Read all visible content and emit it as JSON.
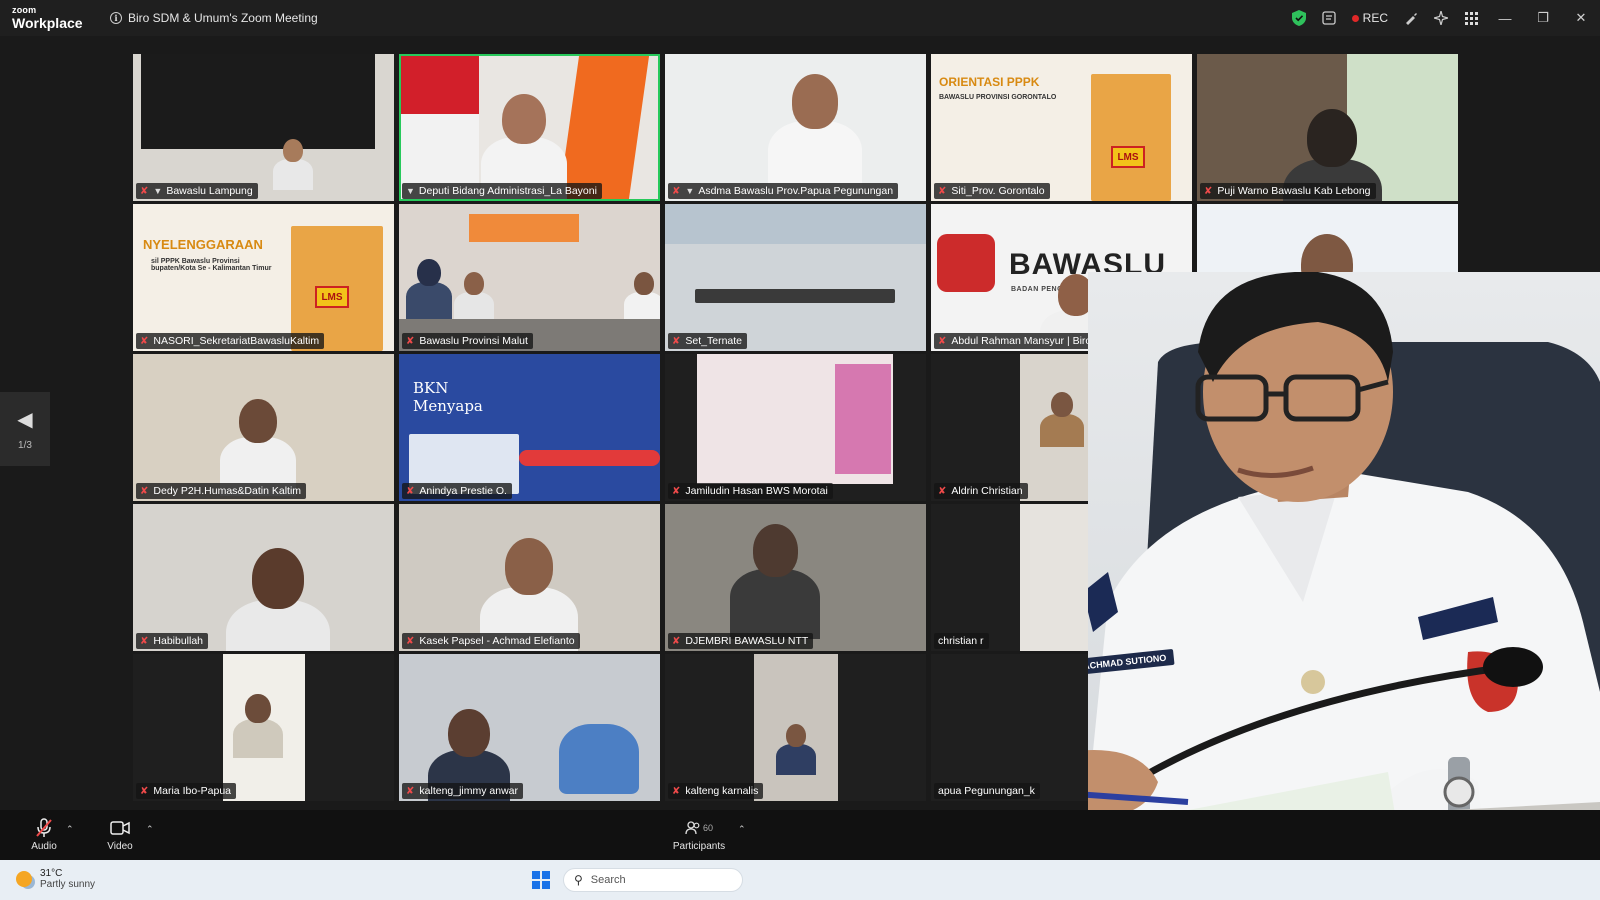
{
  "app": {
    "logo_line1": "zoom",
    "logo_line2": "Workplace",
    "meeting_title": "Biro SDM & Umum's Zoom Meeting",
    "rec_label": "REC",
    "icons": {
      "info": "info-icon",
      "security": "shield-icon",
      "notes": "notes-icon",
      "annotate": "annotate-icon",
      "ai": "sparkle-icon",
      "apps": "grid-icon"
    }
  },
  "participants_grid": [
    {
      "name": "Bawaslu Lampung",
      "muted": true,
      "pinned": true,
      "active": false
    },
    {
      "name": "Deputi Bidang Administrasi_La Bayoni",
      "muted": false,
      "pinned": true,
      "active": true
    },
    {
      "name": "Asdma Bawaslu Prov.Papua Pegunungan",
      "muted": true,
      "pinned": true,
      "active": false
    },
    {
      "name": "Siti_Prov. Gorontalo",
      "muted": true,
      "pinned": false,
      "active": false
    },
    {
      "name": "Puji Warno Bawaslu Kab Lebong",
      "muted": true,
      "pinned": false,
      "active": false
    },
    {
      "name": "NASORI_SekretariatBawasluKaltim",
      "muted": true,
      "pinned": false,
      "active": false
    },
    {
      "name": "Bawaslu Provinsi Malut",
      "muted": true,
      "pinned": false,
      "active": false
    },
    {
      "name": "Set_Ternate",
      "muted": true,
      "pinned": false,
      "active": false
    },
    {
      "name": "Abdul Rahman Mansyur | Biro SDMU",
      "muted": true,
      "pinned": false,
      "active": false
    },
    {
      "name": "",
      "muted": false,
      "pinned": false,
      "active": false
    },
    {
      "name": "Dedy P2H.Humas&Datin Kaltim",
      "muted": true,
      "pinned": false,
      "active": false
    },
    {
      "name": "Anindya Prestie O.",
      "muted": true,
      "pinned": false,
      "active": false
    },
    {
      "name": "Jamiludin Hasan BWS Morotai",
      "muted": true,
      "pinned": false,
      "active": false
    },
    {
      "name": "Aldrin Christian",
      "muted": true,
      "pinned": false,
      "active": false
    },
    {
      "name": "",
      "muted": false,
      "pinned": false,
      "active": false
    },
    {
      "name": "Habibullah",
      "muted": true,
      "pinned": false,
      "active": false
    },
    {
      "name": "Kasek Papsel - Achmad Elefianto",
      "muted": true,
      "pinned": false,
      "active": false
    },
    {
      "name": "DJEMBRI BAWASLU NTT",
      "muted": true,
      "pinned": false,
      "active": false
    },
    {
      "name": "christian r",
      "muted": false,
      "pinned": false,
      "active": false
    },
    {
      "name": "",
      "muted": false,
      "pinned": false,
      "active": false
    },
    {
      "name": "Maria Ibo-Papua",
      "muted": true,
      "pinned": false,
      "active": false
    },
    {
      "name": "kalteng_jimmy anwar",
      "muted": true,
      "pinned": false,
      "active": false
    },
    {
      "name": "kalteng karnalis",
      "muted": true,
      "pinned": false,
      "active": false
    },
    {
      "name": "apua Pegunungan_k",
      "muted": false,
      "pinned": false,
      "active": false
    },
    {
      "name": "",
      "muted": false,
      "pinned": false,
      "active": false
    }
  ],
  "tile_content": {
    "gorontalo_title": "ORIENTASI PPPK",
    "gorontalo_sub": "BAWASLU PROVINSI GORONTALO",
    "kaltim_title": "NYELENGGARAAN",
    "kaltim_sub": "sil PPPK Bawaslu Provinsi\nbupaten/Kota Se - Kalimantan Timur",
    "lms": "LMS",
    "bkn_line1": "BKN",
    "bkn_line2": "Menyapa",
    "bawaslu_logo": "BAWASLU",
    "bawaslu_sub": "BADAN PENGAWAS PEMILIHAN UMUM"
  },
  "overlay": {
    "nametag": "ACHMAD SUTIONO"
  },
  "navigation": {
    "page": "1/3"
  },
  "toolbar": {
    "audio_label": "Audio",
    "video_label": "Video",
    "participants_label": "Participants",
    "participants_count": "60"
  },
  "taskbar": {
    "temperature": "31°C",
    "condition": "Partly sunny",
    "search_placeholder": "Search"
  }
}
